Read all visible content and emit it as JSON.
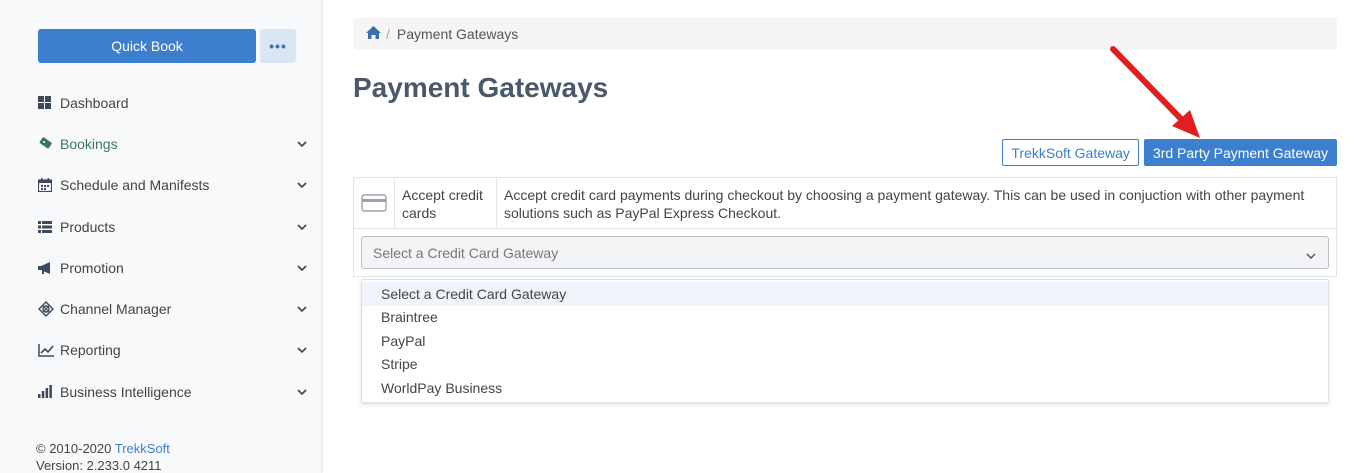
{
  "sidebar": {
    "quick_book": "Quick Book",
    "more": "•••",
    "items": [
      {
        "label": "Dashboard",
        "icon": "dashboard-icon",
        "has_chevron": false
      },
      {
        "label": "Bookings",
        "icon": "ticket-icon",
        "has_chevron": true,
        "active": true
      },
      {
        "label": "Schedule and Manifests",
        "icon": "calendar-icon",
        "has_chevron": true
      },
      {
        "label": "Products",
        "icon": "list-icon",
        "has_chevron": true
      },
      {
        "label": "Promotion",
        "icon": "megaphone-icon",
        "has_chevron": true
      },
      {
        "label": "Channel Manager",
        "icon": "network-icon",
        "has_chevron": true
      },
      {
        "label": "Reporting",
        "icon": "line-chart-icon",
        "has_chevron": true
      },
      {
        "label": "Business Intelligence",
        "icon": "bar-chart-icon",
        "has_chevron": true
      }
    ],
    "footer": {
      "copyright": "© 2010-2020",
      "brand": "TrekkSoft",
      "version": "Version: 2.233.0 4211"
    }
  },
  "breadcrumb": {
    "home_icon": "home-icon",
    "separator": "/",
    "current": "Payment Gateways"
  },
  "page_title": "Payment Gateways",
  "tabs": {
    "trekksoft": "TrekkSoft Gateway",
    "third_party": "3rd Party Payment Gateway"
  },
  "info": {
    "icon": "credit-card-icon",
    "name": "Accept credit cards",
    "description": "Accept credit card payments during checkout by choosing a payment gateway. This can be used in conjuction with other payment solutions such as PayPal Express Checkout."
  },
  "gateway_select": {
    "value": "Select a Credit Card Gateway",
    "options": [
      "Select a Credit Card Gateway",
      "Braintree",
      "PayPal",
      "Stripe",
      "WorldPay Business"
    ]
  },
  "colors": {
    "accent": "#3d7fcf",
    "title": "#49586a",
    "annotation_arrow": "#e02020"
  }
}
